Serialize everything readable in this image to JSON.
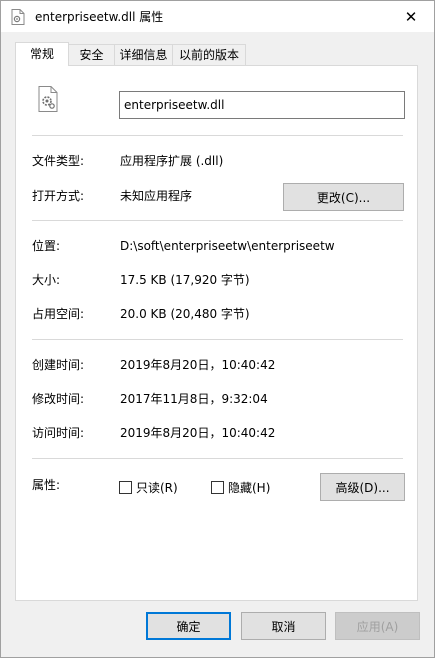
{
  "window": {
    "title": "enterpriseetw.dll 属性",
    "close_glyph": "✕"
  },
  "tabs": [
    {
      "label": "常规",
      "active": true
    },
    {
      "label": "安全",
      "active": false
    },
    {
      "label": "详细信息",
      "active": false
    },
    {
      "label": "以前的版本",
      "active": false
    }
  ],
  "general": {
    "file_name": "enterpriseetw.dll",
    "type_label": "文件类型:",
    "type_value": "应用程序扩展 (.dll)",
    "opens_label": "打开方式:",
    "opens_value": "未知应用程序",
    "change_button": "更改(C)...",
    "location_label": "位置:",
    "location_value": "D:\\soft\\enterpriseetw\\enterpriseetw",
    "size_label": "大小:",
    "size_value": "17.5 KB (17,920 字节)",
    "disk_label": "占用空间:",
    "disk_value": "20.0 KB (20,480 字节)",
    "created_label": "创建时间:",
    "created_value": "2019年8月20日，10:40:42",
    "modified_label": "修改时间:",
    "modified_value": "2017年11月8日，9:32:04",
    "accessed_label": "访问时间:",
    "accessed_value": "2019年8月20日，10:40:42",
    "attributes_label": "属性:",
    "readonly_label": "只读(R)",
    "hidden_label": "隐藏(H)",
    "advanced_button": "高级(D)..."
  },
  "footer": {
    "ok": "确定",
    "cancel": "取消",
    "apply": "应用(A)"
  },
  "colors": {
    "accent": "#0078d7",
    "separator": "#d9d9d9",
    "button_face": "#e1e1e1"
  }
}
